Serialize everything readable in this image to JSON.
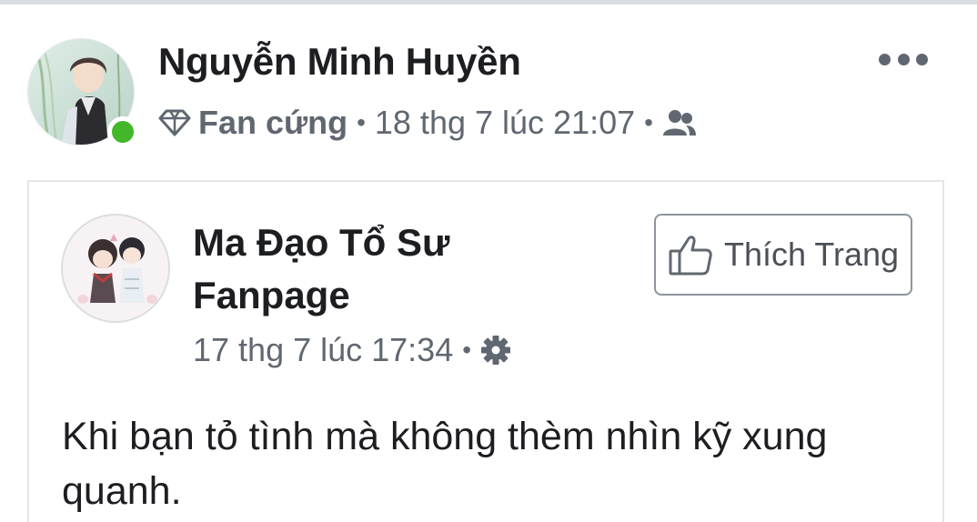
{
  "post": {
    "author_name": "Nguyễn Minh Huyền",
    "author_badge": "Fan cứng",
    "timestamp": "18 thg 7 lúc 21:07",
    "separator": "•",
    "audience_icon": "friends-icon",
    "more_icon": "more-options-icon",
    "online_status_color": "#42b72a"
  },
  "shared_post": {
    "page_name": "Ma Đạo Tổ Sư Fanpage",
    "like_button_label": "Thích Trang",
    "timestamp": "17 thg 7 lúc 17:34",
    "separator": "•",
    "audience_icon": "public-gear-icon",
    "text": "Khi bạn tỏ tình mà không thèm nhìn kỹ xung quanh."
  },
  "colors": {
    "text_primary": "#1c1e21",
    "text_secondary": "#606770",
    "border": "#e4e6eb"
  }
}
